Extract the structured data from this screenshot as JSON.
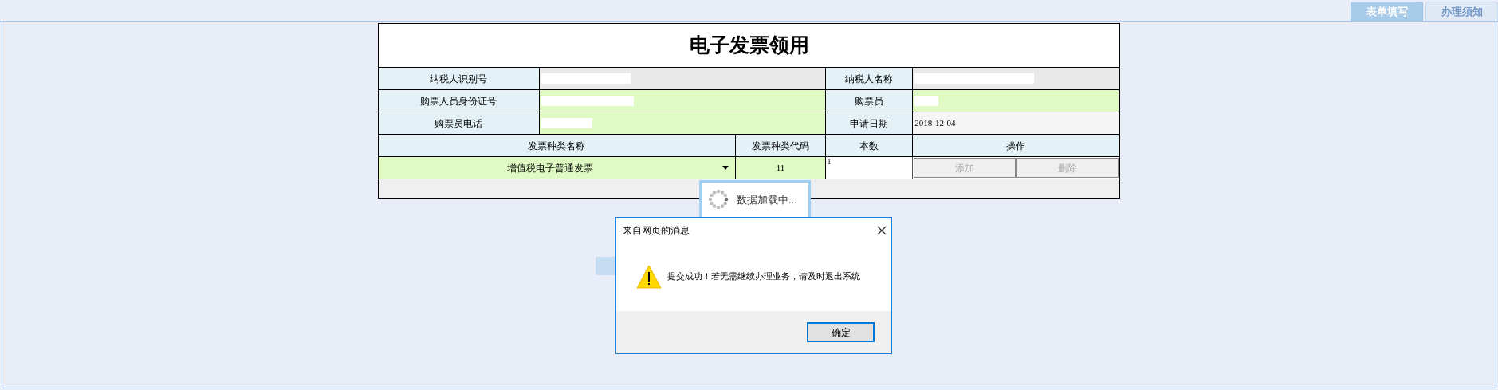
{
  "tabs": [
    {
      "label": "表单填写",
      "selected": true
    },
    {
      "label": "办理须知",
      "selected": false
    }
  ],
  "form": {
    "title": "电子发票领用",
    "fields": [
      {
        "label": "纳税人识别号",
        "kind": "readonly",
        "redacted": true
      },
      {
        "label": "纳税人名称",
        "kind": "readonly",
        "redacted": true
      },
      {
        "label": "购票人员身份证号",
        "kind": "editable",
        "redacted": true
      },
      {
        "label": "购票员",
        "kind": "editable",
        "redacted": true
      },
      {
        "label": "购票员电话",
        "kind": "editable",
        "redacted": true
      },
      {
        "label": "申请日期",
        "kind": "display",
        "value": "2018-12-04"
      }
    ],
    "columns": [
      "发票种类名称",
      "发票种类代码",
      "本数",
      "操作"
    ],
    "items": [
      {
        "name": "增值税电子普通发票",
        "code": "11",
        "count": "1",
        "actions": [
          {
            "label": "添加",
            "disabled": true
          },
          {
            "label": "删除",
            "disabled": true
          }
        ]
      }
    ]
  },
  "loading": {
    "text": "数据加载中..."
  },
  "dialog": {
    "title": "来自网页的消息",
    "message": "提交成功！若无需继续办理业务，请及时退出系统",
    "button": "确定"
  }
}
